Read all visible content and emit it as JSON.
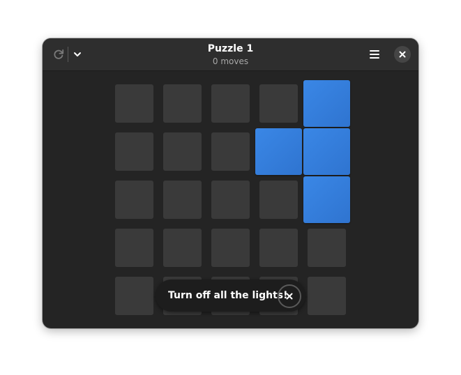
{
  "header": {
    "title": "Puzzle 1",
    "subtitle": "0 moves",
    "icons": {
      "restart": "restart-icon",
      "dropdown": "chevron-down-icon",
      "menu": "hamburger-menu-icon",
      "close": "close-icon"
    }
  },
  "board": {
    "rows": 5,
    "cols": 5,
    "lit": [
      [
        false,
        false,
        false,
        false,
        true
      ],
      [
        false,
        false,
        false,
        true,
        true
      ],
      [
        false,
        false,
        false,
        false,
        true
      ],
      [
        false,
        false,
        false,
        false,
        false
      ],
      [
        false,
        false,
        false,
        false,
        false
      ]
    ]
  },
  "toast": {
    "message": "Turn off all the lights!"
  },
  "colors": {
    "window_bg": "#242424",
    "headerbar_bg": "#2e2e2e",
    "cell_off": "#3a3a3a",
    "cell_on": "#3584e4",
    "toast_bg": "#1d1d1d"
  }
}
